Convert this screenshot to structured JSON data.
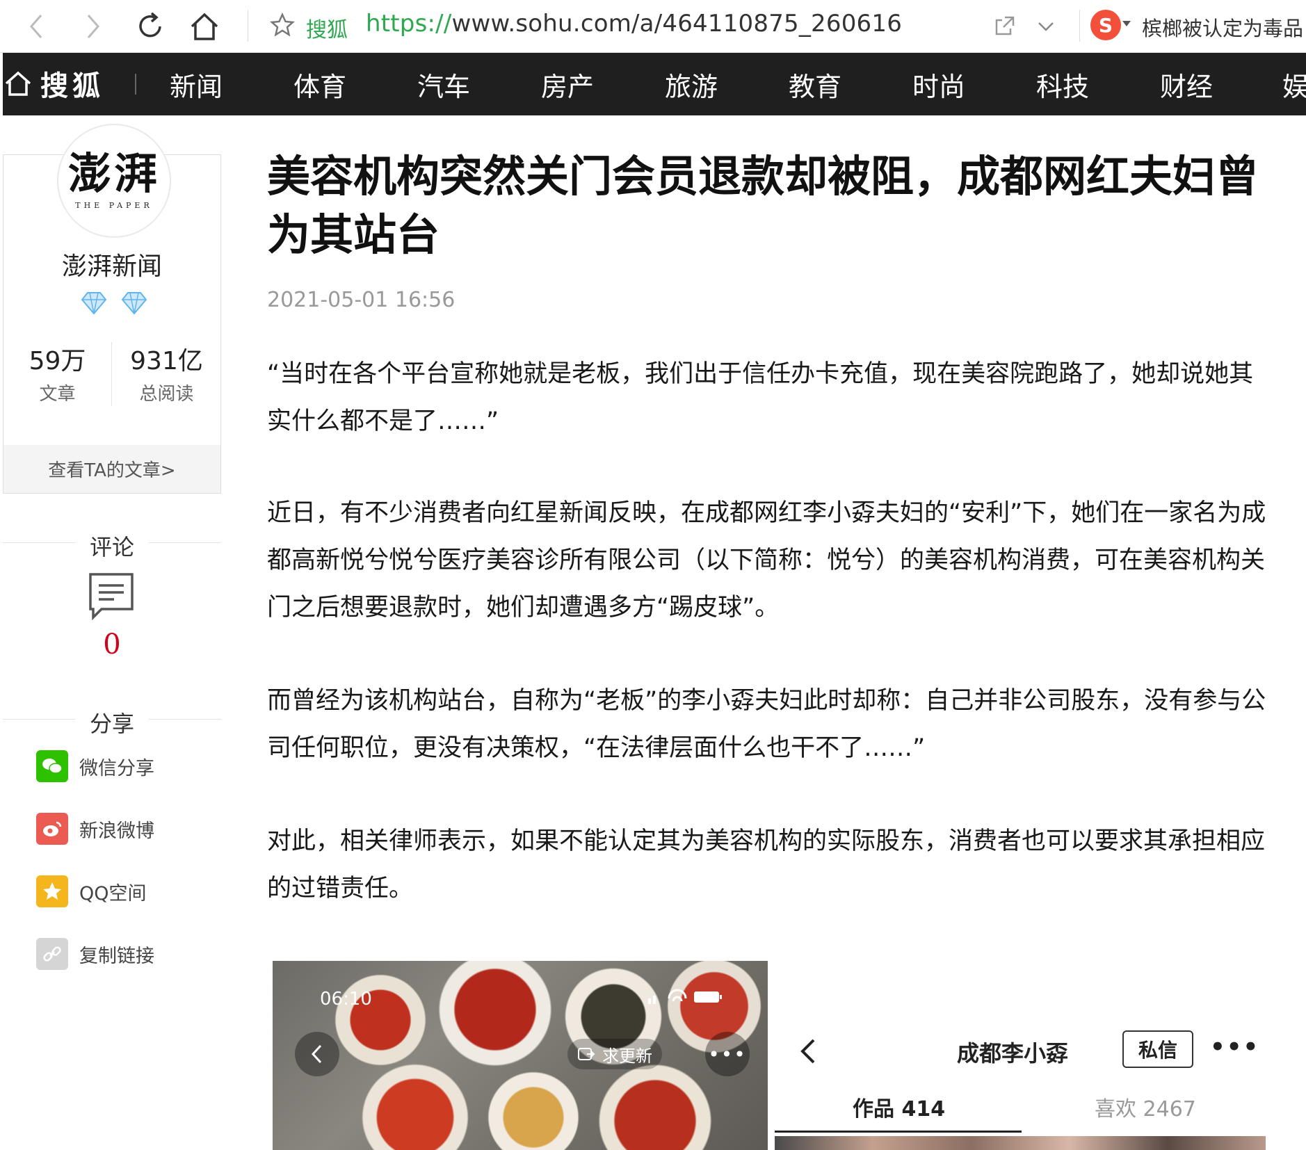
{
  "browser": {
    "site_name": "搜狐",
    "url_scheme": "https://",
    "url_rest": "www.sohu.com/a/464110875_260616",
    "search_hint": "槟榔被认定为毒品"
  },
  "nav": {
    "logo_text": "搜狐",
    "items": [
      "新闻",
      "体育",
      "汽车",
      "房产",
      "旅游",
      "教育",
      "时尚",
      "科技",
      "财经",
      "娱"
    ]
  },
  "sidebar": {
    "avatar_text": "澎湃",
    "avatar_subtext": "THE PAPER",
    "author": "澎湃新闻",
    "stats": [
      {
        "value": "59万",
        "label": "文章"
      },
      {
        "value": "931亿",
        "label": "总阅读"
      }
    ],
    "view_articles": "查看TA的文章>",
    "comment_title": "评论",
    "comment_count": "0",
    "share_title": "分享",
    "share_items": [
      {
        "label": "微信分享",
        "icon": "wechat-icon",
        "color": "#2dc100"
      },
      {
        "label": "新浪微博",
        "icon": "weibo-icon",
        "color": "#ec5b52"
      },
      {
        "label": "QQ空间",
        "icon": "qzone-icon",
        "color": "#f5b51c"
      },
      {
        "label": "复制链接",
        "icon": "link-icon",
        "color": "#d5d5d5"
      }
    ]
  },
  "article": {
    "title": "美容机构突然关门会员退款却被阻，成都网红夫妇曾为其站台",
    "date": "2021-05-01 16:56",
    "paragraphs": [
      "“当时在各个平台宣称她就是老板，我们出于信任办卡充值，现在美容院跑路了，她却说她其实什么都不是了……”",
      "近日，有不少消费者向红星新闻反映，在成都网红李小孬夫妇的“安利”下，她们在一家名为成都高新悦兮悦兮医疗美容诊所有限公司（以下简称：悦兮）的美容机构消费，可在美容机构关门之后想要退款时，她们却遭遇多方“踢皮球”。",
      "而曾经为该机构站台，自称为“老板”的李小孬夫妇此时却称：自己并非公司股东，没有参与公司任何职位，更没有决策权，“在法律层面什么也干不了……”",
      "对此，相关律师表示，如果不能认定其为美容机构的实际股东，消费者也可以要求其承担相应的过错责任。"
    ]
  },
  "screenshot_left": {
    "time": "06:10",
    "update_pill": "求更新"
  },
  "screenshot_right": {
    "name": "成都李小孬",
    "dm_button": "私信",
    "tab_works": "作品 414",
    "tab_likes": "喜欢 2467"
  }
}
